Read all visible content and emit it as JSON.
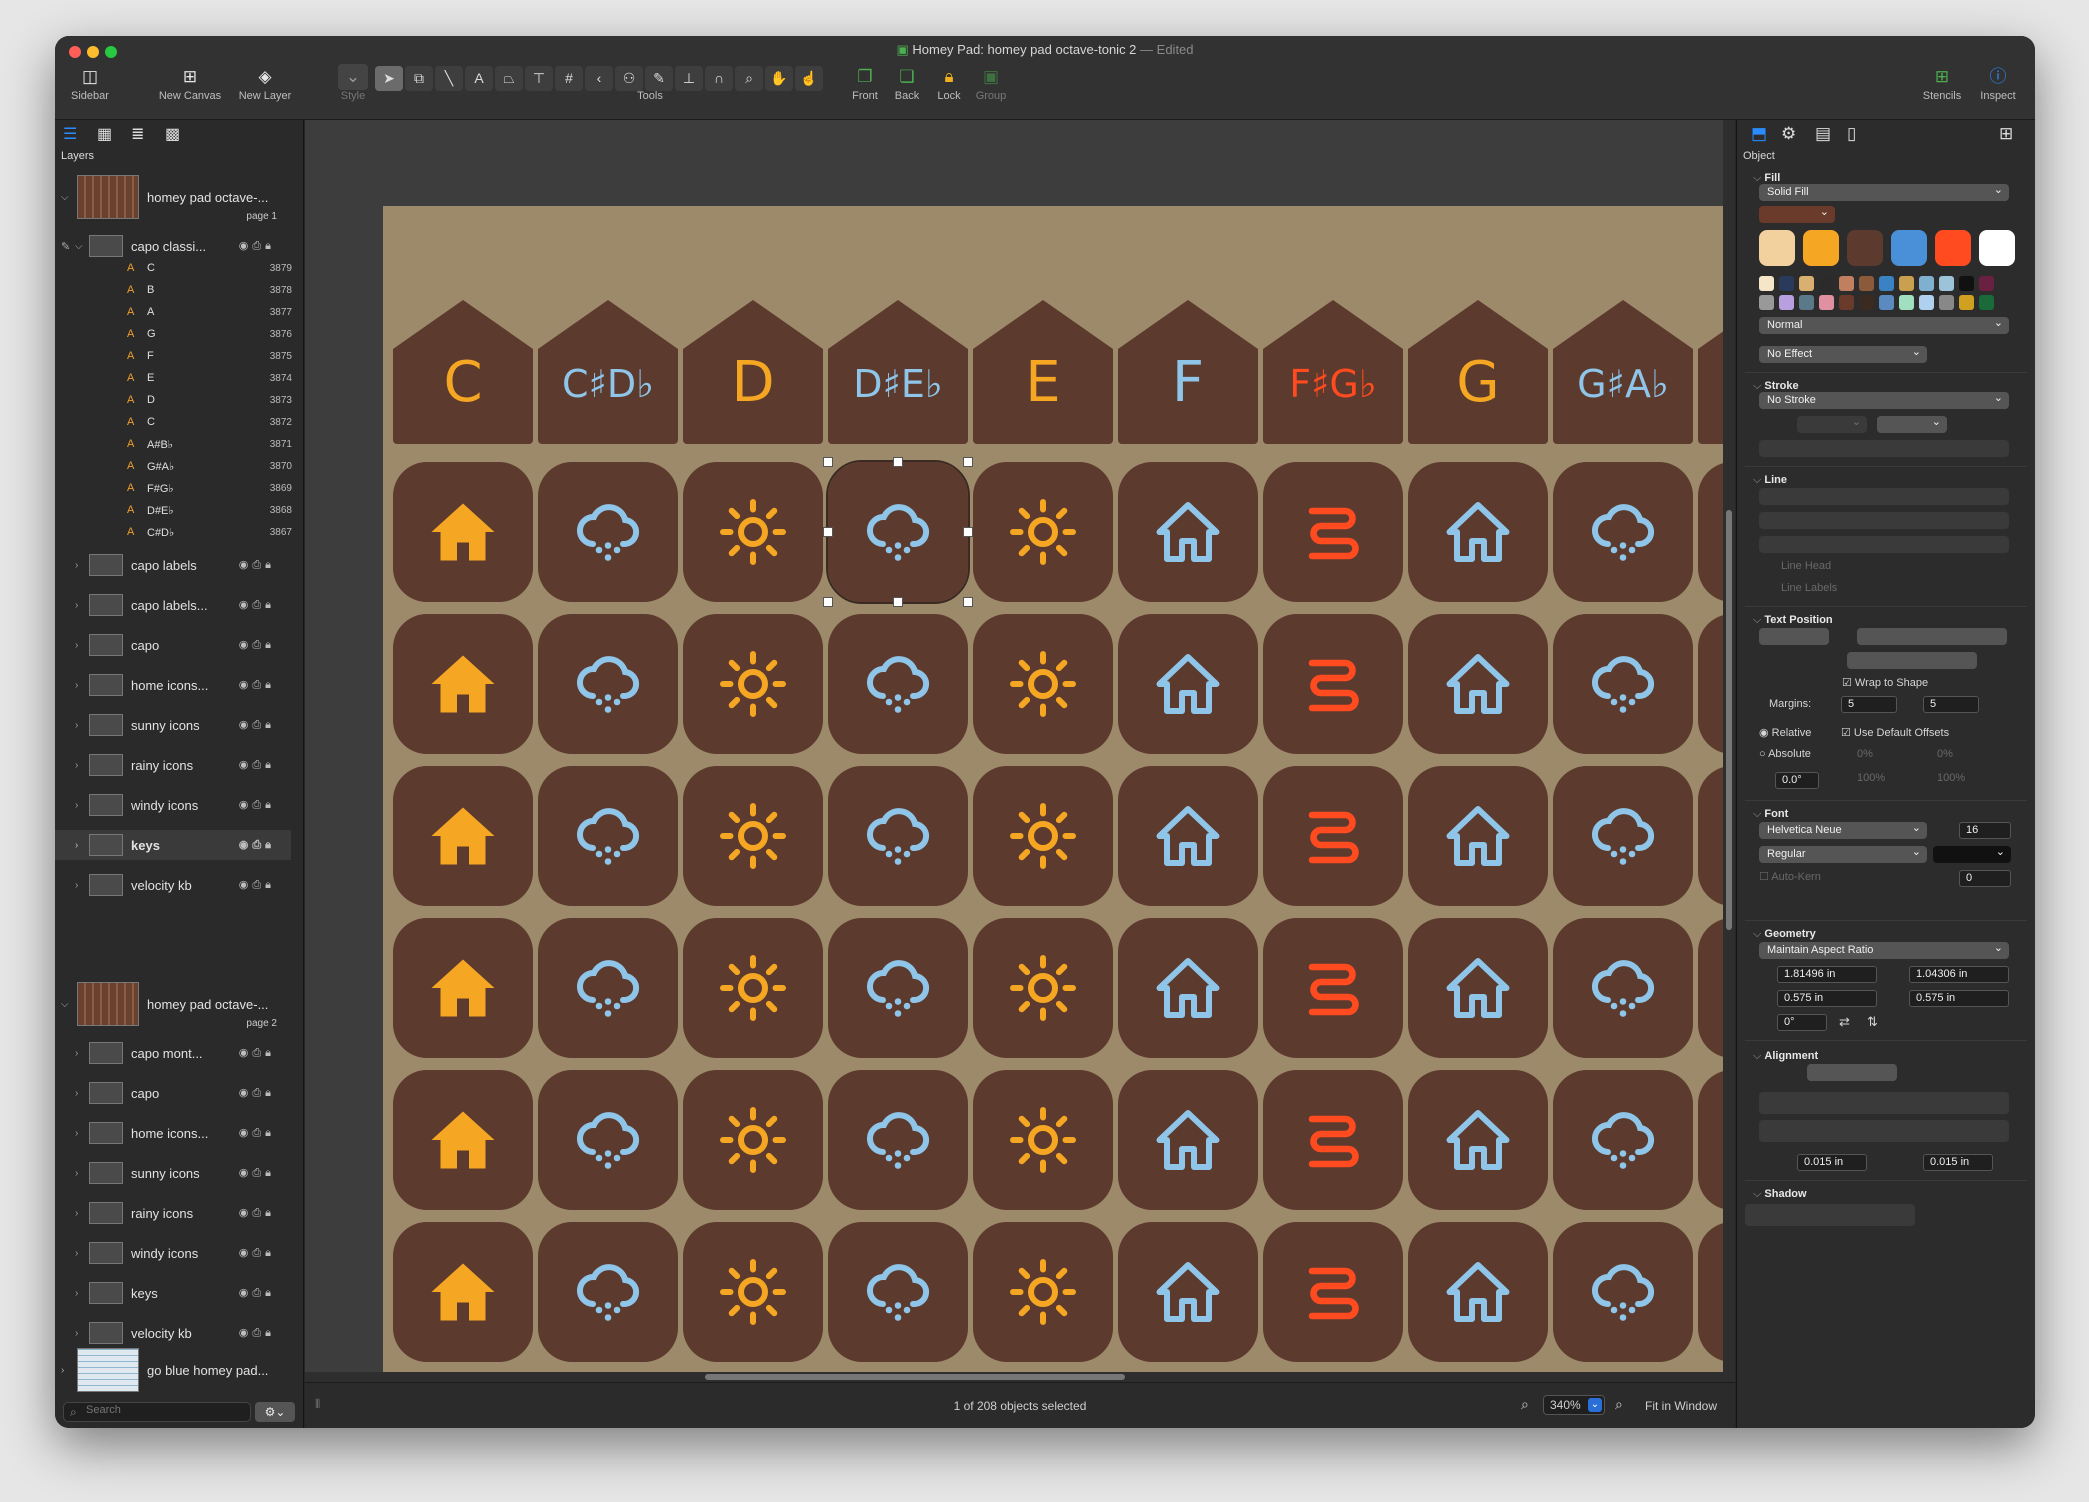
{
  "window": {
    "app_name": "Homey Pad:",
    "doc_title": "homey pad octave-tonic 2",
    "edited": "— Edited"
  },
  "toolbar": {
    "sidebar": "Sidebar",
    "new_canvas": "New Canvas",
    "new_layer": "New Layer",
    "style": "Style",
    "tools": "Tools",
    "front": "Front",
    "back": "Back",
    "lock": "Lock",
    "group": "Group",
    "stencils": "Stencils",
    "inspect": "Inspect"
  },
  "layers": {
    "header": "Layers",
    "canvas1": {
      "name": "homey pad octave-...",
      "page": "page 1"
    },
    "capo_classic": "capo classi...",
    "sublayers": [
      {
        "label": "C",
        "id": "3879"
      },
      {
        "label": "B",
        "id": "3878"
      },
      {
        "label": "A",
        "id": "3877"
      },
      {
        "label": "G",
        "id": "3876"
      },
      {
        "label": "F",
        "id": "3875"
      },
      {
        "label": "E",
        "id": "3874"
      },
      {
        "label": "D",
        "id": "3873"
      },
      {
        "label": "C",
        "id": "3872"
      },
      {
        "label": "A#B♭",
        "id": "3871"
      },
      {
        "label": "G#A♭",
        "id": "3870"
      },
      {
        "label": "F#G♭",
        "id": "3869"
      },
      {
        "label": "D#E♭",
        "id": "3868"
      },
      {
        "label": "C#D♭",
        "id": "3867"
      }
    ],
    "group1": [
      "capo labels",
      "capo labels...",
      "capo",
      "home icons...",
      "sunny icons",
      "rainy icons",
      "windy icons",
      "keys",
      "velocity kb"
    ],
    "canvas2": {
      "name": "homey pad octave-...",
      "page": "page 2"
    },
    "group2": [
      "capo mont...",
      "capo",
      "home icons...",
      "sunny icons",
      "rainy icons",
      "windy icons",
      "keys",
      "velocity kb"
    ],
    "canvas3": {
      "name": "go blue homey pad..."
    },
    "search_placeholder": "Search"
  },
  "canvas": {
    "keys": [
      {
        "label": "C",
        "color": "#f5a623"
      },
      {
        "label": "C♯D♭",
        "color": "#8ec5e8"
      },
      {
        "label": "D",
        "color": "#f5a623"
      },
      {
        "label": "D♯E♭",
        "color": "#8ec5e8"
      },
      {
        "label": "E",
        "color": "#f5a623"
      },
      {
        "label": "F",
        "color": "#8ec5e8"
      },
      {
        "label": "F♯G♭",
        "color": "#ff4b1f"
      },
      {
        "label": "G",
        "color": "#f5a623"
      },
      {
        "label": "G♯A♭",
        "color": "#8ec5e8"
      }
    ],
    "icon_columns": [
      "house-filled",
      "cloud-rain",
      "sun",
      "cloud-rain",
      "sun",
      "house-outline",
      "wind",
      "house-outline",
      "cloud-rain"
    ],
    "colors": {
      "orange": "#f5a623",
      "blue": "#8ec5e8",
      "red": "#ff4b1f",
      "pad": "#5c3a2d",
      "bg": "#9c8a6a"
    }
  },
  "status": {
    "selection": "1 of 208 objects selected",
    "zoom": "340%",
    "fit": "Fit in Window"
  },
  "inspector": {
    "section": "Object",
    "fill": {
      "title": "Fill",
      "type": "Solid Fill",
      "blend": "Normal",
      "effect": "No Effect"
    },
    "stroke": {
      "title": "Stroke",
      "type": "No Stroke"
    },
    "line": {
      "title": "Line",
      "head": "Line Head",
      "labels": "Line Labels"
    },
    "text_position": {
      "title": "Text Position",
      "wrap": "Wrap to Shape",
      "margins": "Margins:",
      "m1": "5",
      "m2": "5",
      "relative": "Relative",
      "absolute": "Absolute",
      "default_offsets": "Use Default Offsets",
      "angle": "0.0°",
      "p0": "0%",
      "p1": "0%",
      "p2": "100%",
      "p3": "100%"
    },
    "font": {
      "title": "Font",
      "family": "Helvetica Neue",
      "size": "16",
      "style": "Regular",
      "autokern": "Auto-Kern",
      "kern": "0"
    },
    "geometry": {
      "title": "Geometry",
      "mode": "Maintain Aspect Ratio",
      "x": "1.81496 in",
      "y": "1.04306 in",
      "w": "0.575 in",
      "h": "0.575 in",
      "rot": "0°"
    },
    "alignment": {
      "title": "Alignment",
      "ox": "0.015 in",
      "oy": "0.015 in"
    },
    "shadow": {
      "title": "Shadow"
    },
    "swatches": [
      "#f2d19e",
      "#f5a623",
      "#5c3a2d",
      "#4a90d9",
      "#ff4b1f",
      "#ffffff"
    ],
    "small_swatches": [
      "#f5e6c8",
      "#2a3a5a",
      "#d9b070",
      "#2b2b2b",
      "#c08060",
      "#8a5a3a",
      "#3b82c4",
      "#c9a050",
      "#7fb0d0",
      "#9cc4d8",
      "#111111",
      "#6a2040",
      "#999999",
      "#b8a0e0",
      "#5a7a8a",
      "#e090a0",
      "#6a3a2a",
      "#3a2a20",
      "#5a8ac0",
      "#a0e0c0",
      "#b0d0f0",
      "#888888",
      "#d0a020",
      "#1a6a3a"
    ]
  }
}
